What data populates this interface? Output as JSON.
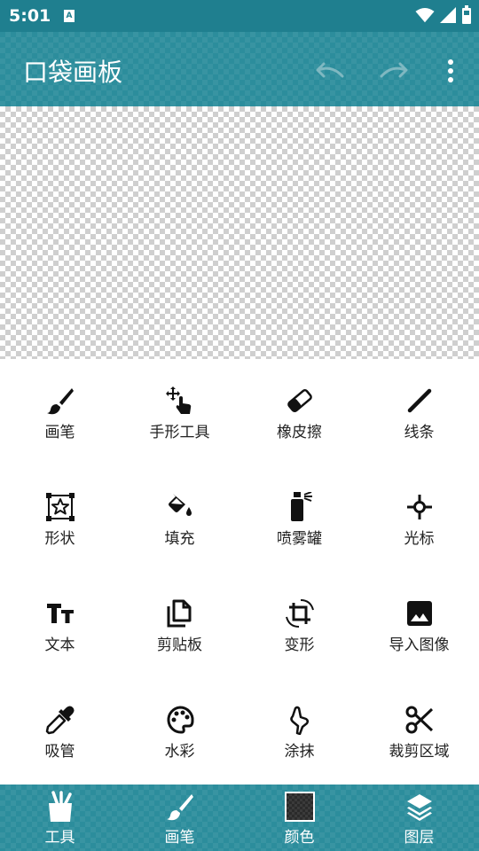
{
  "status_bar": {
    "time": "5:01",
    "notification_badge": "A"
  },
  "app_bar": {
    "title": "口袋画板",
    "icons": [
      "undo-icon",
      "redo-icon",
      "overflow-menu-icon"
    ]
  },
  "tools": [
    {
      "label": "画笔",
      "icon": "brush-icon"
    },
    {
      "label": "手形工具",
      "icon": "hand-icon"
    },
    {
      "label": "橡皮擦",
      "icon": "eraser-icon"
    },
    {
      "label": "线条",
      "icon": "line-icon"
    },
    {
      "label": "形状",
      "icon": "shape-icon"
    },
    {
      "label": "填充",
      "icon": "fill-icon"
    },
    {
      "label": "喷雾罐",
      "icon": "spray-icon"
    },
    {
      "label": "光标",
      "icon": "cursor-icon"
    },
    {
      "label": "文本",
      "icon": "text-icon"
    },
    {
      "label": "剪贴板",
      "icon": "clipboard-icon"
    },
    {
      "label": "变形",
      "icon": "transform-icon"
    },
    {
      "label": "导入图像",
      "icon": "image-icon"
    },
    {
      "label": "吸管",
      "icon": "pipette-icon"
    },
    {
      "label": "水彩",
      "icon": "palette-icon"
    },
    {
      "label": "涂抹",
      "icon": "smudge-icon"
    },
    {
      "label": "裁剪区域",
      "icon": "scissors-icon"
    }
  ],
  "bottom_nav": [
    {
      "label": "工具",
      "icon": "tools-icon"
    },
    {
      "label": "画笔",
      "icon": "brush-icon"
    },
    {
      "label": "颜色",
      "icon": "color-swatch"
    },
    {
      "label": "图层",
      "icon": "layers-icon"
    }
  ],
  "colors": {
    "primary": "#2c8d9c",
    "status_bar": "#1f7f8f",
    "current_color": "#2b2b2b"
  }
}
